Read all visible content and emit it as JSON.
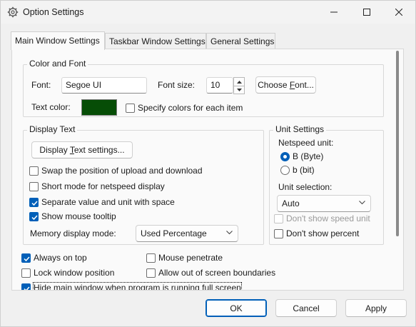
{
  "window": {
    "title": "Option Settings"
  },
  "tabs": [
    {
      "label": "Main Window Settings",
      "active": true
    },
    {
      "label": "Taskbar Window Settings",
      "active": false
    },
    {
      "label": "General Settings",
      "active": false
    }
  ],
  "color_font": {
    "group_title": "Color and Font",
    "font_label": "Font:",
    "font_value": "Segoe UI",
    "font_size_label": "Font size:",
    "font_size_value": "10",
    "choose_font_pre": "Choose ",
    "choose_font_u": "F",
    "choose_font_post": "ont...",
    "text_color_label": "Text color:",
    "text_color": "#064d06",
    "specify_colors_label": "Specify colors for each item",
    "specify_colors_checked": false
  },
  "display_text": {
    "group_title": "Display Text",
    "settings_btn_pre": "Display ",
    "settings_btn_u": "T",
    "settings_btn_post": "ext settings...",
    "swap_label": "Swap the position of upload and download",
    "short_mode_label": "Short mode for netspeed display",
    "separate_label": "Separate value and unit with space",
    "tooltip_label": "Show mouse tooltip",
    "memory_label": "Memory display mode:",
    "memory_value": "Used Percentage"
  },
  "unit_settings": {
    "group_title": "Unit Settings",
    "netspeed_label": "Netspeed unit:",
    "byte_label": "B (Byte)",
    "bit_label": "b (bit)",
    "unit_selection_label": "Unit selection:",
    "unit_selection_value": "Auto",
    "dont_show_speed_unit": "Don't show speed unit",
    "dont_show_percent": "Don't show percent"
  },
  "bottom_options": {
    "always_on_top": "Always on top",
    "mouse_penetrate": "Mouse penetrate",
    "lock_position": "Lock window position",
    "allow_out_of_screen": "Allow out of screen boundaries",
    "hide_fullscreen": "Hide main window when program is running full screen"
  },
  "footer": {
    "ok": "OK",
    "cancel": "Cancel",
    "apply": "Apply"
  },
  "colors": {
    "accent": "#005fb8"
  }
}
